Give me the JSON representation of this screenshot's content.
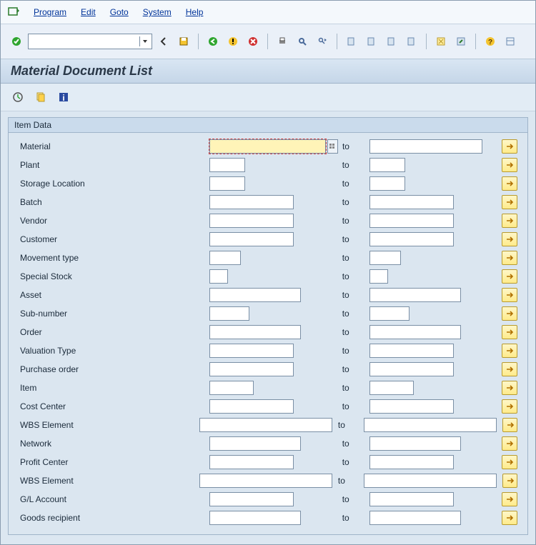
{
  "menu": {
    "program": "Program",
    "edit": "Edit",
    "goto": "Goto",
    "system": "System",
    "help": "Help"
  },
  "title": "Material Document List",
  "group_title": "Item Data",
  "to_label": "to",
  "fields": [
    {
      "id": "material",
      "label": "Material",
      "from_w": 165,
      "to_w": 150,
      "required": true,
      "f4": true
    },
    {
      "id": "plant",
      "label": "Plant",
      "from_w": 42,
      "to_w": 42
    },
    {
      "id": "storage_location",
      "label": "Storage Location",
      "from_w": 42,
      "to_w": 42
    },
    {
      "id": "batch",
      "label": "Batch",
      "from_w": 110,
      "to_w": 110
    },
    {
      "id": "vendor",
      "label": "Vendor",
      "from_w": 110,
      "to_w": 110
    },
    {
      "id": "customer",
      "label": "Customer",
      "from_w": 110,
      "to_w": 110
    },
    {
      "id": "movement_type",
      "label": "Movement type",
      "from_w": 36,
      "to_w": 36
    },
    {
      "id": "special_stock",
      "label": "Special Stock",
      "from_w": 18,
      "to_w": 18
    },
    {
      "id": "asset",
      "label": "Asset",
      "from_w": 120,
      "to_w": 120
    },
    {
      "id": "sub_number",
      "label": "Sub-number",
      "from_w": 48,
      "to_w": 48
    },
    {
      "id": "order",
      "label": "Order",
      "from_w": 120,
      "to_w": 120
    },
    {
      "id": "valuation_type",
      "label": "Valuation Type",
      "from_w": 110,
      "to_w": 110
    },
    {
      "id": "purchase_order",
      "label": "Purchase order",
      "from_w": 110,
      "to_w": 110
    },
    {
      "id": "item",
      "label": "Item",
      "from_w": 54,
      "to_w": 54
    },
    {
      "id": "cost_center",
      "label": "Cost Center",
      "from_w": 110,
      "to_w": 110
    },
    {
      "id": "wbs_element",
      "label": "WBS Element",
      "from_w": 178,
      "to_w": 178,
      "wide": true
    },
    {
      "id": "network",
      "label": "Network",
      "from_w": 120,
      "to_w": 120
    },
    {
      "id": "profit_center",
      "label": "Profit Center",
      "from_w": 110,
      "to_w": 110
    },
    {
      "id": "wbs_element_2",
      "label": "WBS Element",
      "from_w": 178,
      "to_w": 178,
      "wide": true
    },
    {
      "id": "gl_account",
      "label": "G/L Account",
      "from_w": 110,
      "to_w": 110
    },
    {
      "id": "goods_recipient",
      "label": "Goods recipient",
      "from_w": 120,
      "to_w": 120
    }
  ]
}
